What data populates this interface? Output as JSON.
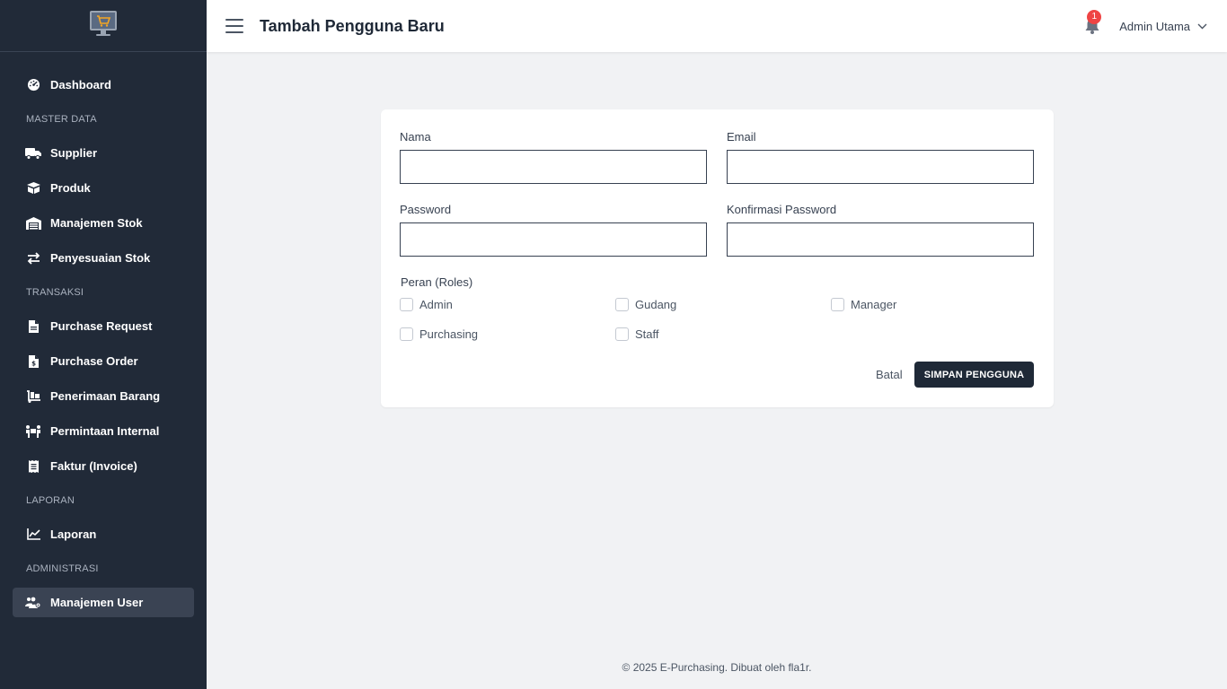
{
  "app": {
    "logo_icon": "monitor-cart-icon"
  },
  "header": {
    "title": "Tambah Pengguna Baru",
    "notification_count": "1",
    "user_name": "Admin Utama"
  },
  "sidebar": {
    "dashboard": {
      "label": "Dashboard",
      "icon": "gauge-icon"
    },
    "section_master": "MASTER DATA",
    "supplier": {
      "label": "Supplier",
      "icon": "truck-icon"
    },
    "produk": {
      "label": "Produk",
      "icon": "box-icon"
    },
    "manajemen_stok": {
      "label": "Manajemen Stok",
      "icon": "warehouse-icon"
    },
    "penyesuaian_stok": {
      "label": "Penyesuaian Stok",
      "icon": "exchange-icon"
    },
    "section_transaksi": "TRANSAKSI",
    "purchase_request": {
      "label": "Purchase Request",
      "icon": "file-icon"
    },
    "purchase_order": {
      "label": "Purchase Order",
      "icon": "file-invoice-icon"
    },
    "penerimaan_barang": {
      "label": "Penerimaan Barang",
      "icon": "dolly-icon"
    },
    "permintaan_internal": {
      "label": "Permintaan Internal",
      "icon": "people-carry-icon"
    },
    "faktur": {
      "label": "Faktur (Invoice)",
      "icon": "receipt-icon"
    },
    "section_laporan": "LAPORAN",
    "laporan": {
      "label": "Laporan",
      "icon": "chart-line-icon"
    },
    "section_admin": "ADMINISTRASI",
    "manajemen_user": {
      "label": "Manajemen User",
      "icon": "users-cog-icon",
      "active": true
    }
  },
  "form": {
    "nama": {
      "label": "Nama",
      "value": ""
    },
    "email": {
      "label": "Email",
      "value": ""
    },
    "password": {
      "label": "Password",
      "value": ""
    },
    "konfirmasi": {
      "label": "Konfirmasi Password",
      "value": ""
    },
    "roles_label": "Peran (Roles)",
    "roles": {
      "admin": {
        "label": "Admin",
        "checked": false
      },
      "gudang": {
        "label": "Gudang",
        "checked": false
      },
      "manager": {
        "label": "Manager",
        "checked": false
      },
      "purchasing": {
        "label": "Purchasing",
        "checked": false
      },
      "staff": {
        "label": "Staff",
        "checked": false
      }
    },
    "cancel_label": "Batal",
    "save_label": "SIMPAN PENGGUNA"
  },
  "footer": {
    "text": "© 2025 E-Purchasing. Dibuat oleh fla1r."
  },
  "colors": {
    "sidebar_bg": "#212a38",
    "sidebar_active": "#3a4353",
    "primary_button": "#1f2937",
    "badge": "#ef4444",
    "page_bg": "#f1f2f4",
    "logo_accent": "#f5a623"
  }
}
